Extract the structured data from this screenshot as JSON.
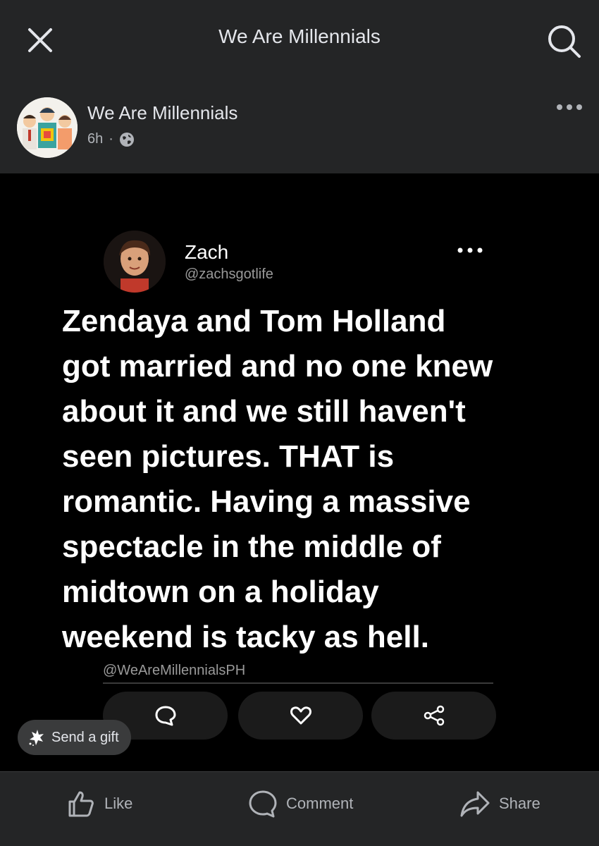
{
  "topbar": {
    "title": "We Are Millennials",
    "close_icon": "close-icon",
    "search_icon": "search-icon"
  },
  "post": {
    "page_name": "We Are Millennials",
    "time": "6h",
    "separator": "·",
    "privacy_icon": "globe-icon",
    "more_icon": "more-horizontal-icon"
  },
  "tweet": {
    "name": "Zach",
    "handle": "@zachsgotlife",
    "text": "Zendaya and Tom Holland\ngot married and no one knew\nabout it and we still haven't\nseen pictures. THAT is\nromantic. Having a massive\nspectacle in the middle of\nmidtown on a holiday\nweekend is tacky as hell.",
    "watermark": "@WeAreMillennialsPH"
  },
  "gift": {
    "label": "Send a gift"
  },
  "actions": {
    "like": "Like",
    "comment": "Comment",
    "share": "Share"
  },
  "colors": {
    "background": "#242526",
    "image_background": "#000000",
    "text": "#e4e6eb",
    "secondary_text": "#b0b3b8"
  }
}
